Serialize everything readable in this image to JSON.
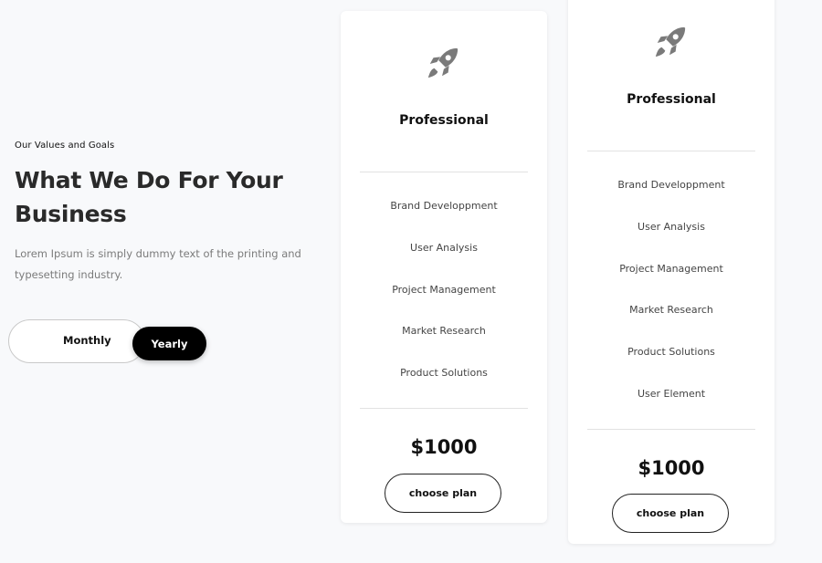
{
  "intro": {
    "eyebrow": "Our Values and Goals",
    "headline": "What We Do For Your Business",
    "lead": "Lorem Ipsum is simply dummy text of the printing and typesetting industry."
  },
  "billing_toggle": {
    "monthly": "Monthly",
    "yearly": "Yearly",
    "selected": "Yearly"
  },
  "plans": [
    {
      "icon": "rocket-icon",
      "name": "Professional",
      "features": [
        "Brand Developpment",
        "User Analysis",
        "Project Management",
        "Market Research",
        "Product Solutions"
      ],
      "price": "$1000",
      "cta": "choose plan"
    },
    {
      "icon": "rocket-icon",
      "name": "Professional",
      "features": [
        "Brand Developpment",
        "User Analysis",
        "Project Management",
        "Market Research",
        "Product Solutions",
        "User Element"
      ],
      "price": "$1000",
      "cta": "choose plan"
    }
  ],
  "colors": {
    "background": "#f8f9fb",
    "card": "#ffffff",
    "accent": "#000000",
    "icon": "#7a7a7a"
  }
}
